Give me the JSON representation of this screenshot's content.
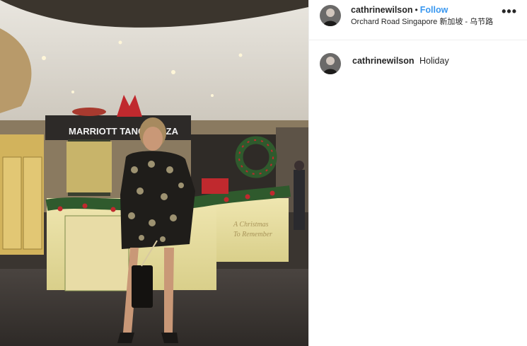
{
  "post": {
    "username": "cathrinewilson",
    "separator": "•",
    "follow_label": "Follow",
    "location": "Orchard Road Singapore 新加坡 - 乌节路",
    "more_icon": "more-options-icon"
  },
  "caption": {
    "username": "cathrinewilson",
    "text": "Holiday"
  },
  "photo": {
    "store_sign": "MARRIOTT TANG PLAZA",
    "window_text_line1": "A Christmas",
    "window_text_line2": "To Remember"
  }
}
